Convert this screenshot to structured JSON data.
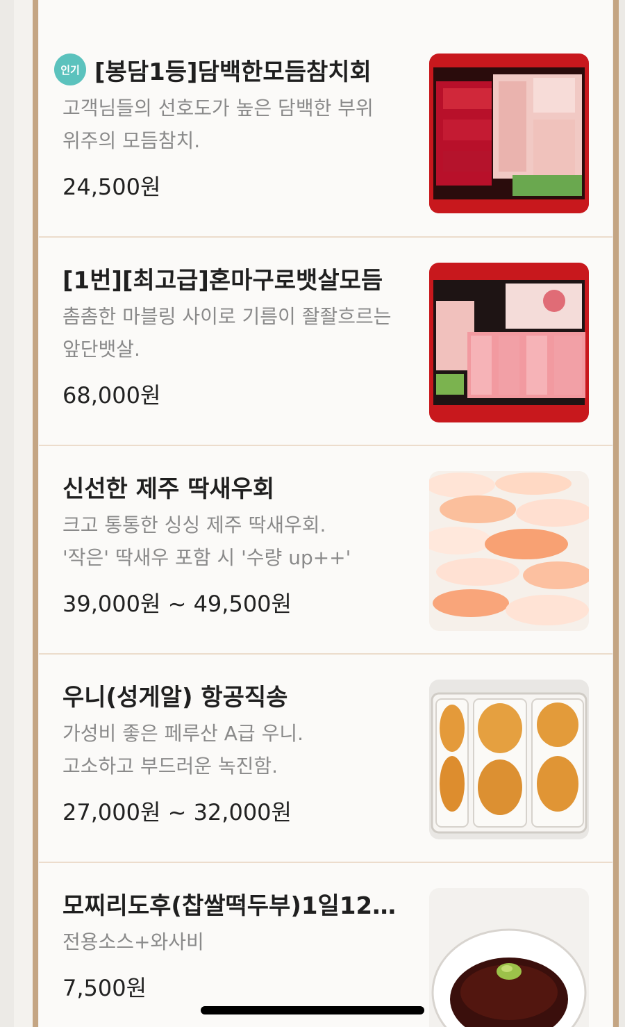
{
  "menu": {
    "items": [
      {
        "badge": "인기",
        "title": "[봉담1등]담백한모듬참치회",
        "desc1": "고객님들의 선호도가 높은 담백한 부위",
        "desc2": "위주의 모듬참치.",
        "price": "24,500원",
        "image": "tuna-assortment-icon"
      },
      {
        "title": "[1번][최고급]혼마구로뱃살모듬",
        "desc1": "촘촘한 마블링 사이로 기름이 좔좔흐르는",
        "desc2": "앞단뱃살.",
        "price": "68,000원",
        "image": "tuna-belly-icon"
      },
      {
        "title": "신선한 제주 딱새우회",
        "desc1": "크고 통통한 싱싱 제주 딱새우회.",
        "desc2": "'작은' 딱새우 포함 시 '수량 up++'",
        "price": "39,000원 ~ 49,500원",
        "image": "shrimp-sashimi-icon"
      },
      {
        "title": "우니(성게알) 항공직송",
        "desc1": "가성비 좋은 페루산 A급 우니.",
        "desc2": "고소하고 부드러운  녹진함.",
        "price": "27,000원 ~ 32,000원",
        "image": "sea-urchin-icon"
      },
      {
        "title": "모찌리도후(찹쌀떡두부)1일12개…",
        "desc1": "전용소스+와사비",
        "price": "7,500원",
        "image": "mochi-tofu-icon"
      }
    ]
  },
  "colors": {
    "accent_badge": "#5bc2bd",
    "rail": "#c4a583",
    "tray_red": "#c8181d"
  }
}
